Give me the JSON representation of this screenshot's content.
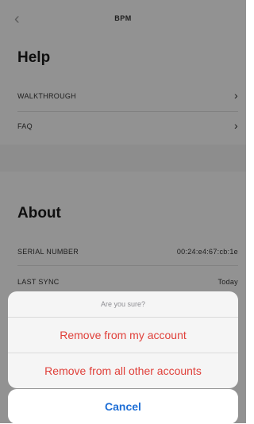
{
  "nav": {
    "back_icon": "chevron-left-icon",
    "title": "BPM"
  },
  "help": {
    "heading": "Help",
    "items": [
      {
        "label": "WALKTHROUGH",
        "icon": "chevron-right-icon"
      },
      {
        "label": "FAQ",
        "icon": "chevron-right-icon"
      }
    ]
  },
  "about": {
    "heading": "About",
    "items": [
      {
        "label": "SERIAL NUMBER",
        "value": "00:24:e4:67:cb:1e"
      },
      {
        "label": "LAST SYNC",
        "value": "Today"
      }
    ]
  },
  "action_sheet": {
    "title": "Are you sure?",
    "actions": [
      {
        "label": "Remove from my account"
      },
      {
        "label": "Remove from all other accounts"
      }
    ],
    "cancel_label": "Cancel"
  },
  "colors": {
    "destructive": "#e0403a",
    "cancel": "#1f6fd6"
  }
}
